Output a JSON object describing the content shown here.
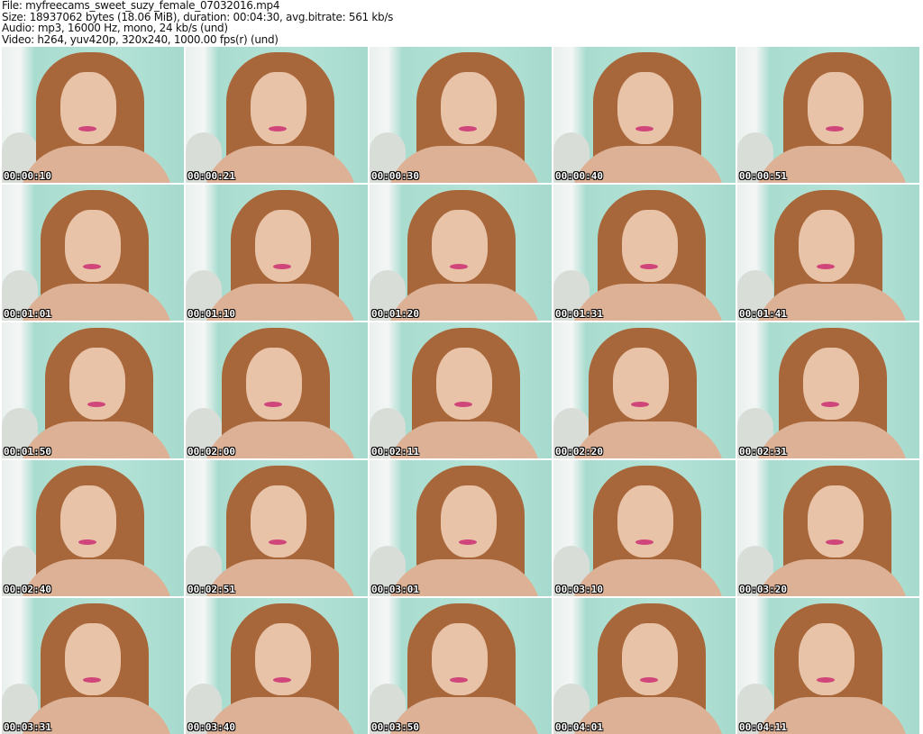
{
  "info": {
    "file": "File: myfreecams_sweet_suzy_female_07032016.mp4",
    "size": "Size: 18937062 bytes (18.06 MiB), duration: 00:04:30, avg.bitrate: 561 kb/s",
    "audio": "Audio: mp3, 16000 Hz, mono, 24 kb/s (und)",
    "video": "Video: h264, yuv420p, 320x240, 1000.00 fps(r) (und)"
  },
  "thumbnails": [
    "00:00:10",
    "00:00:21",
    "00:00:30",
    "00:00:40",
    "00:00:51",
    "00:01:01",
    "00:01:10",
    "00:01:20",
    "00:01:31",
    "00:01:41",
    "00:01:50",
    "00:02:00",
    "00:02:11",
    "00:02:20",
    "00:02:31",
    "00:02:40",
    "00:02:51",
    "00:03:01",
    "00:03:10",
    "00:03:20",
    "00:03:31",
    "00:03:40",
    "00:03:50",
    "00:04:01",
    "00:04:11"
  ]
}
